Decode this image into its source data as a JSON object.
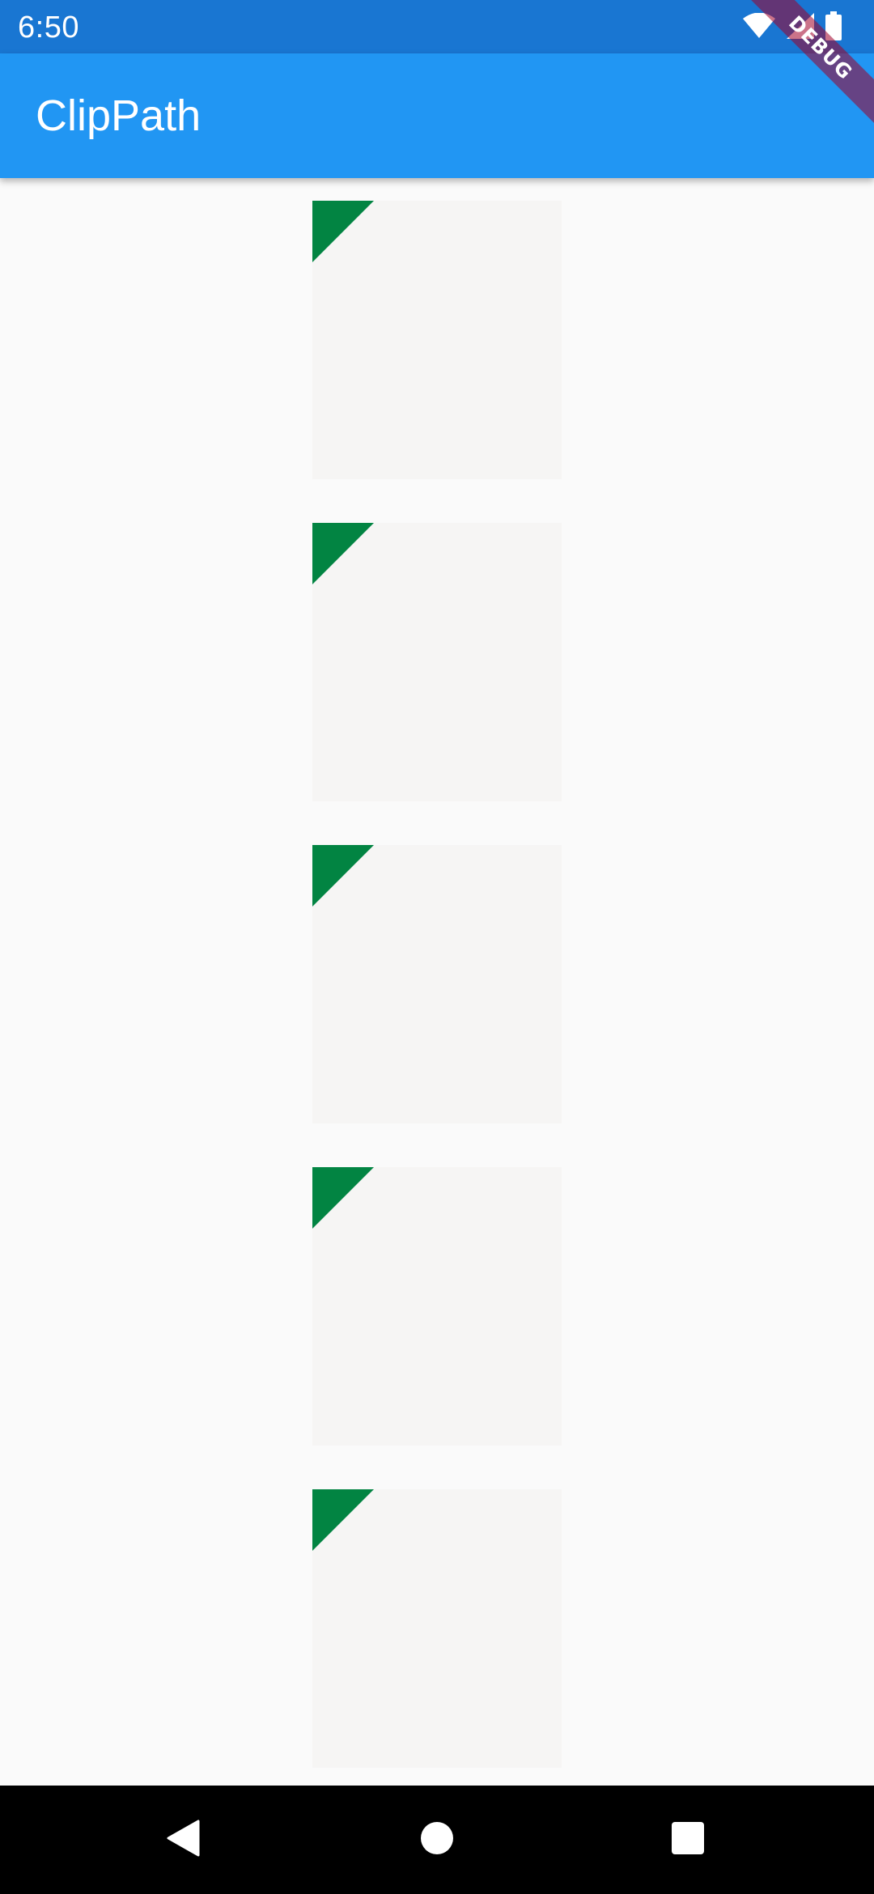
{
  "status_bar": {
    "time": "6:50",
    "icons": [
      "wifi-icon",
      "cellular-signal-icon",
      "battery-icon"
    ]
  },
  "app_bar": {
    "title": "ClipPath"
  },
  "debug_banner": {
    "label": "DEBUG"
  },
  "colors": {
    "status_bar": "#1976d2",
    "app_bar": "#2196f3",
    "background": "#fafafa",
    "card": "#f6f5f4",
    "clip_triangle": "#028442",
    "nav_bar": "#000000"
  },
  "list": {
    "item_count": 5,
    "item_shape": "square-with-clipped-green-top-left-triangle"
  },
  "nav_bar": {
    "buttons": [
      "back-icon",
      "home-icon",
      "recents-icon"
    ]
  }
}
